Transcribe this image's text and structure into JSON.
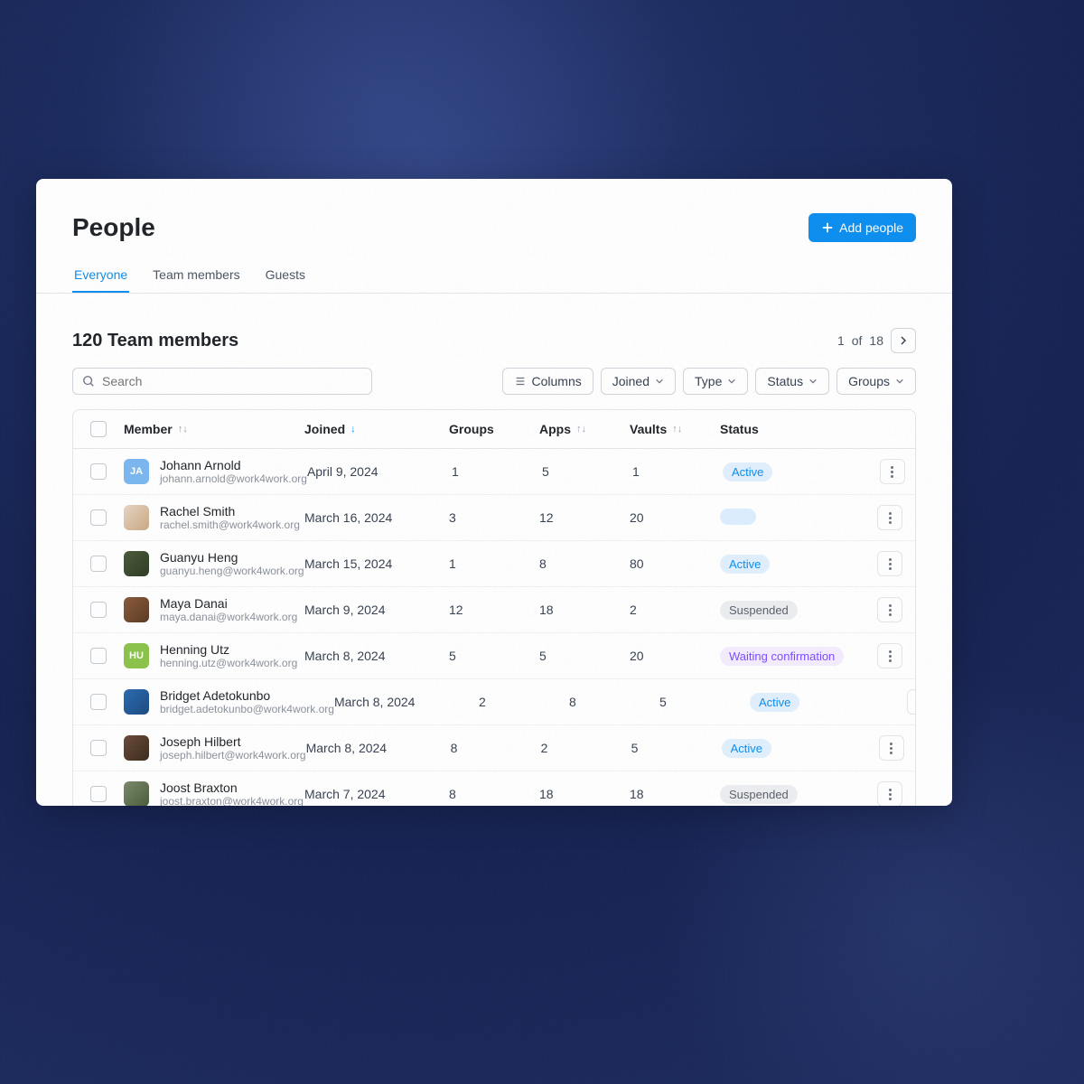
{
  "title": "People",
  "add_label": "Add people",
  "tabs": [
    "Everyone",
    "Team members",
    "Guests"
  ],
  "active_tab": 0,
  "count_text": "120 Team members",
  "pagination": {
    "current": "1",
    "of": "of",
    "total": "18"
  },
  "search": {
    "placeholder": "Search"
  },
  "filters": {
    "columns": "Columns",
    "joined": "Joined",
    "type": "Type",
    "status": "Status",
    "groups": "Groups"
  },
  "columns": {
    "member": "Member",
    "joined": "Joined",
    "groups": "Groups",
    "apps": "Apps",
    "vaults": "Vaults",
    "status": "Status"
  },
  "rows": [
    {
      "name": "Johann Arnold",
      "email": "johann.arnold@work4work.org",
      "joined": "April 9, 2024",
      "groups": "1",
      "apps": "5",
      "vaults": "1",
      "status": "Active",
      "avatar": {
        "type": "initials",
        "text": "JA",
        "bg": "#7ab7f0"
      }
    },
    {
      "name": "Rachel Smith",
      "email": "rachel.smith@work4work.org",
      "joined": "March 16, 2024",
      "groups": "3",
      "apps": "12",
      "vaults": "20",
      "status": "",
      "avatar": {
        "type": "photo",
        "bg": "linear-gradient(135deg,#e8d5c4,#c9a882)"
      }
    },
    {
      "name": "Guanyu Heng",
      "email": "guanyu.heng@work4work.org",
      "joined": "March 15, 2024",
      "groups": "1",
      "apps": "8",
      "vaults": "80",
      "status": "Active",
      "avatar": {
        "type": "photo",
        "bg": "linear-gradient(135deg,#4a5a3a,#2d3a22)"
      }
    },
    {
      "name": "Maya Danai",
      "email": "maya.danai@work4work.org",
      "joined": "March 9, 2024",
      "groups": "12",
      "apps": "18",
      "vaults": "2",
      "status": "Suspended",
      "avatar": {
        "type": "photo",
        "bg": "linear-gradient(135deg,#8b5a3a,#5a3a22)"
      }
    },
    {
      "name": "Henning Utz",
      "email": "henning.utz@work4work.org",
      "joined": "March 8, 2024",
      "groups": "5",
      "apps": "5",
      "vaults": "20",
      "status": "Waiting confirmation",
      "avatar": {
        "type": "initials",
        "text": "HU",
        "bg": "#8bc34a"
      }
    },
    {
      "name": "Bridget Adetokunbo",
      "email": "bridget.adetokunbo@work4work.org",
      "joined": "March 8, 2024",
      "groups": "2",
      "apps": "8",
      "vaults": "5",
      "status": "Active",
      "avatar": {
        "type": "photo",
        "bg": "linear-gradient(135deg,#2a6ab0,#1a4a80)"
      }
    },
    {
      "name": "Joseph Hilbert",
      "email": "joseph.hilbert@work4work.org",
      "joined": "March 8, 2024",
      "groups": "8",
      "apps": "2",
      "vaults": "5",
      "status": "Active",
      "avatar": {
        "type": "photo",
        "bg": "linear-gradient(135deg,#6a4a3a,#3a2a1a)"
      }
    },
    {
      "name": "Joost Braxton",
      "email": "joost.braxton@work4work.org",
      "joined": "March 7, 2024",
      "groups": "8",
      "apps": "18",
      "vaults": "18",
      "status": "Suspended",
      "avatar": {
        "type": "photo",
        "bg": "linear-gradient(135deg,#7a8a6a,#4a5a3a)"
      }
    }
  ]
}
